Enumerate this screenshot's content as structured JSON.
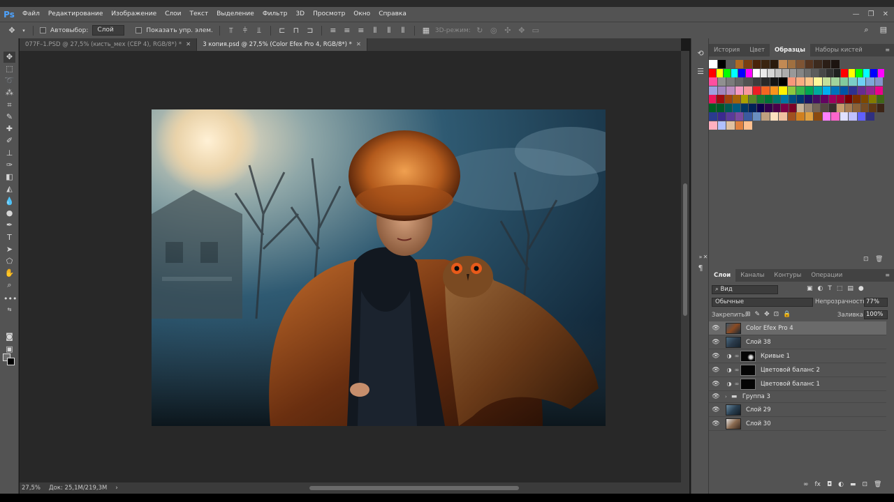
{
  "menubar": {
    "logo": "Ps",
    "items": [
      "Файл",
      "Редактирование",
      "Изображение",
      "Слои",
      "Текст",
      "Выделение",
      "Фильтр",
      "3D",
      "Просмотр",
      "Окно",
      "Справка"
    ]
  },
  "options": {
    "autoselect_label": "Автовыбор:",
    "autoselect_value": "Слой",
    "show_controls_label": "Показать упр. элем.",
    "mode_3d_label": "3D-режим:"
  },
  "tabs": [
    {
      "label": "077F–1.PSD @ 27,5% (кисть_мех (CEP 4), RGB/8*) *",
      "active": false
    },
    {
      "label": "3 копия.psd @ 27,5% (Color Efex Pro 4, RGB/8*) *",
      "active": true
    }
  ],
  "status": {
    "zoom": "27,5%",
    "doc": "Док: 25,1M/219,3M"
  },
  "swatches_panel": {
    "tabs": [
      "История",
      "Цвет",
      "Образцы",
      "Наборы кистей"
    ],
    "active_tab": "Образцы"
  },
  "swatch_rows": [
    [
      "#ffffff",
      "#000000",
      "#5a5a5a",
      "#b06a24",
      "#7a3f12",
      "#4a2208",
      "#3a2410",
      "#2a1a0c",
      "#c28a54",
      "#a07040",
      "#7e5434",
      "#553521",
      "#3c2a1e",
      "#2b1e16",
      "#1c1410"
    ],
    [
      "#ff0000",
      "#ffff00",
      "#00ff00",
      "#00ffff",
      "#0000ff",
      "#ff00ff",
      "#ffffff",
      "#ebebeb",
      "#d6d6d6",
      "#c2c2c2",
      "#adadad",
      "#999999",
      "#858585",
      "#707070",
      "#5c5c5c",
      "#474747",
      "#333333",
      "#1f1f1f",
      "#ff0000",
      "#ffff00",
      "#00ff00",
      "#00ffff",
      "#0000ff",
      "#ff00ff"
    ],
    [
      "#ff4fa0",
      "#909090",
      "#7b7b7b",
      "#666666",
      "#525252",
      "#3d3d3d",
      "#292929",
      "#141414",
      "#000000",
      "#f7977a",
      "#f9ad81",
      "#fdc68a",
      "#fff79a",
      "#c4df9b",
      "#a2d39c",
      "#82ca9d",
      "#7bcdc8",
      "#6ecff6",
      "#7ea7d8",
      "#8493ca"
    ],
    [
      "#a0a0e0",
      "#a187be",
      "#bc8dbf",
      "#f49ac2",
      "#f6989d",
      "#ed1c24",
      "#f26522",
      "#f7941d",
      "#fff200",
      "#8dc73f",
      "#39b54a",
      "#00a651",
      "#00a99d",
      "#00aeef",
      "#0072bc",
      "#0054a6",
      "#2e3192",
      "#662d91",
      "#92278f",
      "#ec008c"
    ],
    [
      "#ed145b",
      "#9e0b0f",
      "#a0410d",
      "#a3620a",
      "#aba000",
      "#598527",
      "#197b30",
      "#007236",
      "#00746b",
      "#0076a3",
      "#004b80",
      "#003471",
      "#1b1464",
      "#440e62",
      "#630460",
      "#9e005d",
      "#9e0039",
      "#790000",
      "#7b2e00",
      "#7d4900",
      "#827b00",
      "#406618"
    ],
    [
      "#005e20",
      "#005826",
      "#005952",
      "#005b7f",
      "#003663",
      "#002157",
      "#0d004c",
      "#32004b",
      "#4b0049",
      "#7b0046",
      "#7a0026",
      "#c7b299",
      "#998675",
      "#736357",
      "#534741",
      "#37302d",
      "#c69c6d",
      "#a67c52",
      "#8c6239",
      "#754c24",
      "#603913",
      "#3c2415"
    ],
    [
      "#2a3b8f",
      "#3b2a8f",
      "#5a3a9a",
      "#7a4aa0",
      "#3b5a9f",
      "#6a8fc0",
      "#c0a080",
      "#fde0c0",
      "#f0c0a0",
      "#a05020",
      "#d08020",
      "#e0a040",
      "#8a4a10",
      "#ff80ff",
      "#ff66cc",
      "#e0e0ff",
      "#c0c0ff",
      "#6060ff",
      "#303080"
    ],
    [
      "#ffb0c0",
      "#b0c0ff",
      "#e0c0a0",
      "#e08040",
      "#ffc090"
    ]
  ],
  "layers_panel": {
    "tabs": [
      "Слои",
      "Каналы",
      "Контуры",
      "Операции"
    ],
    "active_tab": "Слои",
    "filter": "Вид",
    "blend_mode": "Обычные",
    "opacity_label": "Непрозрачность:",
    "opacity": "77%",
    "lock_label": "Закрепить:",
    "fill_label": "Заливка:",
    "fill": "100%"
  },
  "layers": [
    {
      "name": "Color Efex Pro 4",
      "kind": "image",
      "selected": true
    },
    {
      "name": "Слой 38",
      "kind": "image",
      "selected": false
    },
    {
      "name": "Кривые 1",
      "kind": "adjustment",
      "selected": false
    },
    {
      "name": "Цветовой баланс 2",
      "kind": "adjustment",
      "selected": false
    },
    {
      "name": "Цветовой баланс 1",
      "kind": "adjustment",
      "selected": false
    },
    {
      "name": "Группа 3",
      "kind": "group",
      "selected": false
    },
    {
      "name": "Слой 29",
      "kind": "image",
      "selected": false
    },
    {
      "name": "Слой 30",
      "kind": "image",
      "selected": false
    }
  ]
}
